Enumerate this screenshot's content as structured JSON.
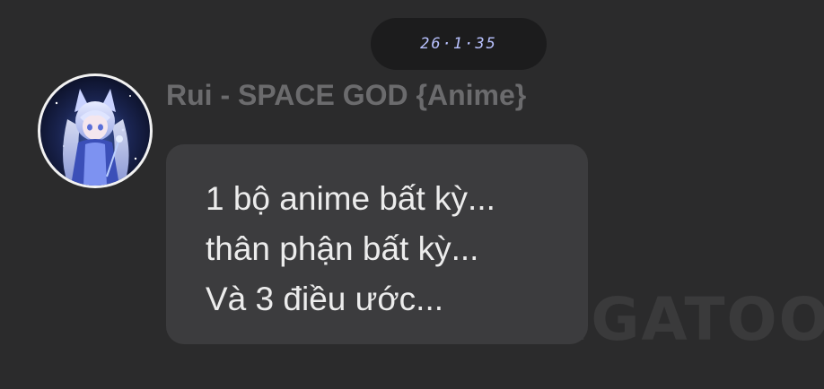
{
  "chat": {
    "timestamp": "26·1·35",
    "sender": {
      "name": "Rui - SPACE GOD {Anime}",
      "avatar_icon": "anime-girl-avatar"
    },
    "message": {
      "lines": [
        "1 bộ anime bất kỳ...",
        "thân phận bất kỳ...",
        "Và 3 điều ước..."
      ]
    }
  },
  "watermark": {
    "text": "ANGATOO"
  },
  "colors": {
    "background": "#2b2b2c",
    "bubble": "#3c3c3e",
    "timestamp_pill": "#1c1c1d",
    "timestamp_text": "#b9c2ff",
    "sender_name": "#6b6b6d",
    "message_text": "#ececec"
  }
}
